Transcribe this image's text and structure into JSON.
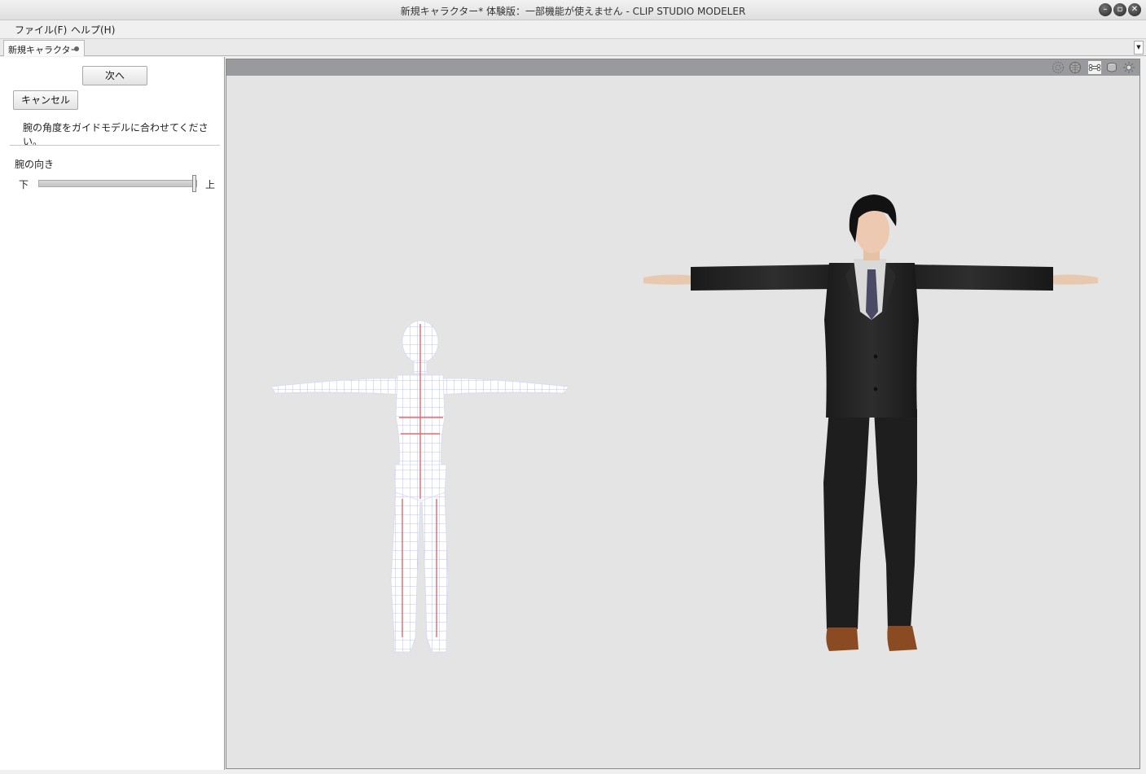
{
  "window": {
    "title": "新規キャラクター* 体験版：一部機能が使えません - CLIP STUDIO MODELER",
    "controls": [
      "minimize-icon",
      "restore-icon",
      "close-icon"
    ]
  },
  "menu": {
    "file": "ファイル(F)",
    "help": "ヘルプ(H)"
  },
  "tabs": {
    "active": "新規キャラクター*"
  },
  "panel": {
    "next_button": "次へ",
    "cancel_button": "キャンセル",
    "instruction": "腕の角度をガイドモデルに合わせてください。",
    "arm_direction_label": "腕の向き",
    "slider_min_label": "下",
    "slider_max_label": "上",
    "slider_value": 1.0
  },
  "viewport": {
    "toolbar_icons": [
      "wireframe-icon",
      "sphere-grid-icon",
      "bone-icon",
      "solid-icon",
      "light-icon"
    ],
    "colors": {
      "background": "#e4e4e4",
      "toolbar": "#999a9d",
      "suit": "#222222",
      "skin": "#e9c8b0",
      "shoes": "#8a4a22",
      "hair": "#111111",
      "guide_grid_blue": "#9aa8e8",
      "guide_grid_red": "#e06060"
    }
  }
}
